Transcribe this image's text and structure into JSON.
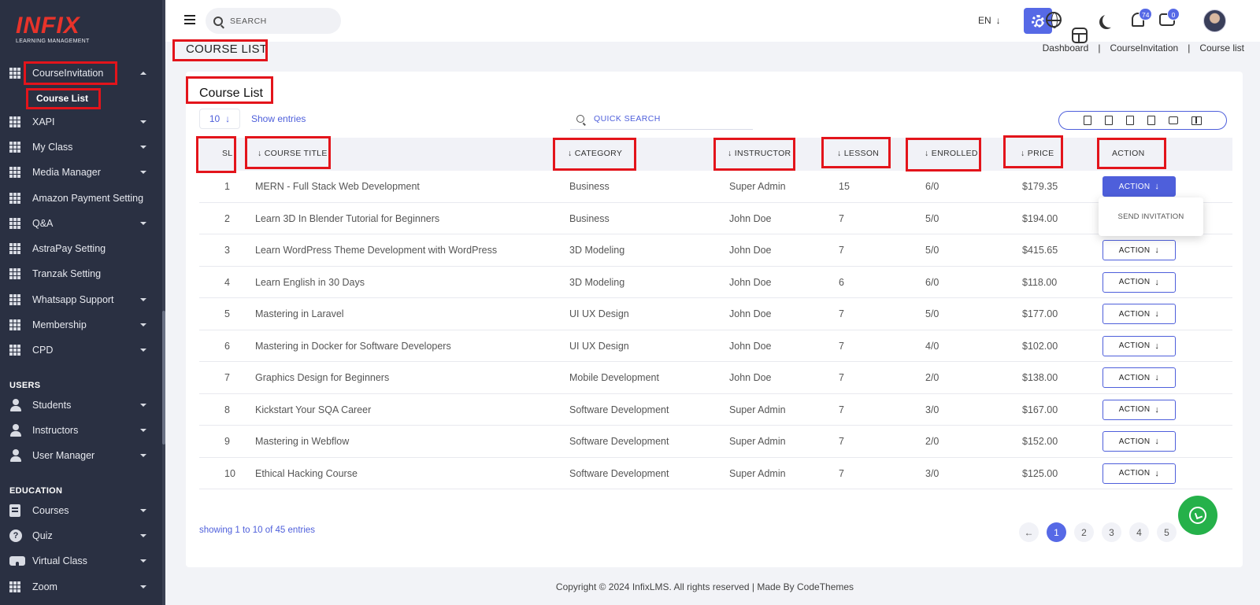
{
  "brand": {
    "name": "INFIX",
    "subtitle": "LEARNING MANAGEMENT"
  },
  "sidebar": {
    "items": [
      {
        "label": "CourseInvitation",
        "expanded": true
      },
      {
        "label": "XAPI"
      },
      {
        "label": "My Class"
      },
      {
        "label": "Media Manager"
      },
      {
        "label": "Amazon Payment Setting"
      },
      {
        "label": "Q&A"
      },
      {
        "label": "AstraPay Setting"
      },
      {
        "label": "Tranzak Setting"
      },
      {
        "label": "Whatsapp Support"
      },
      {
        "label": "Membership"
      },
      {
        "label": "CPD"
      }
    ],
    "sub_item": "Course List",
    "users_section": "USERS",
    "users_items": [
      "Students",
      "Instructors",
      "User Manager"
    ],
    "education_section": "EDUCATION",
    "education_items": [
      "Courses",
      "Quiz",
      "Virtual Class",
      "Zoom"
    ]
  },
  "topbar": {
    "search_placeholder": "SEARCH",
    "language": "EN",
    "notification_count": "74",
    "message_count": "0"
  },
  "page": {
    "title": "COURSE LIST",
    "breadcrumb": [
      "Dashboard",
      "CourseInvitation",
      "Course list"
    ]
  },
  "card": {
    "title": "Course List",
    "entries_value": "10",
    "entries_label": "Show entries",
    "quick_search_placeholder": "QUICK SEARCH"
  },
  "table": {
    "headers": {
      "sl": "SL",
      "title": "COURSE TITLE",
      "category": "CATEGORY",
      "instructor": "INSTRUCTOR",
      "lesson": "LESSON",
      "enrolled": "ENROLLED",
      "price": "PRICE",
      "action": "ACTION"
    },
    "action_label": "ACTION",
    "dropdown_item": "SEND INVITATION",
    "rows": [
      {
        "sl": "1",
        "title": "MERN - Full Stack Web Development",
        "category": "Business",
        "instructor": "Super Admin",
        "lesson": "15",
        "enrolled": "6/0",
        "price": "$179.35"
      },
      {
        "sl": "2",
        "title": "Learn 3D In Blender Tutorial for Beginners",
        "category": "Business",
        "instructor": "John Doe",
        "lesson": "7",
        "enrolled": "5/0",
        "price": "$194.00"
      },
      {
        "sl": "3",
        "title": "Learn WordPress Theme Development with WordPress",
        "category": "3D Modeling",
        "instructor": "John Doe",
        "lesson": "7",
        "enrolled": "5/0",
        "price": "$415.65"
      },
      {
        "sl": "4",
        "title": "Learn English in 30 Days",
        "category": "3D Modeling",
        "instructor": "John Doe",
        "lesson": "6",
        "enrolled": "6/0",
        "price": "$118.00"
      },
      {
        "sl": "5",
        "title": "Mastering in Laravel",
        "category": "UI UX Design",
        "instructor": "John Doe",
        "lesson": "7",
        "enrolled": "5/0",
        "price": "$177.00"
      },
      {
        "sl": "6",
        "title": "Mastering in Docker for Software Developers",
        "category": "UI UX Design",
        "instructor": "John Doe",
        "lesson": "7",
        "enrolled": "4/0",
        "price": "$102.00"
      },
      {
        "sl": "7",
        "title": "Graphics Design for Beginners",
        "category": "Mobile Development",
        "instructor": "John Doe",
        "lesson": "7",
        "enrolled": "2/0",
        "price": "$138.00"
      },
      {
        "sl": "8",
        "title": "Kickstart Your SQA Career",
        "category": "Software Development",
        "instructor": "Super Admin",
        "lesson": "7",
        "enrolled": "3/0",
        "price": "$167.00"
      },
      {
        "sl": "9",
        "title": "Mastering in Webflow",
        "category": "Software Development",
        "instructor": "Super Admin",
        "lesson": "7",
        "enrolled": "2/0",
        "price": "$152.00"
      },
      {
        "sl": "10",
        "title": "Ethical Hacking Course",
        "category": "Software Development",
        "instructor": "Super Admin",
        "lesson": "7",
        "enrolled": "3/0",
        "price": "$125.00"
      }
    ]
  },
  "footer_info": {
    "showing": "showing 1 to 10 of 45 entries",
    "pages": [
      "1",
      "2",
      "3",
      "4",
      "5"
    ],
    "copyright": "Copyright © 2024 InfixLMS. All rights reserved | Made By CodeThemes"
  },
  "colors": {
    "accent": "#5669e6",
    "sidebar": "#2a3042",
    "highlight": "#e3141b",
    "whatsapp": "#25b14a"
  }
}
